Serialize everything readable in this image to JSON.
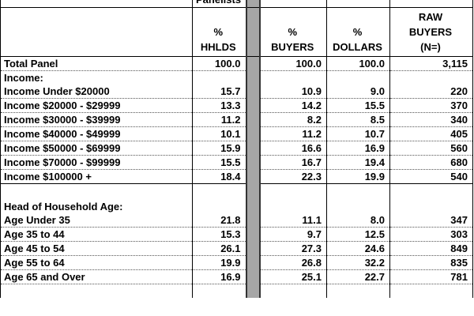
{
  "header": {
    "panelists_label": "Panelists",
    "col_hhlds_pct": "%",
    "col_hhlds": "HHLDS",
    "col_buyers_pct": "%",
    "col_buyers": "BUYERS",
    "col_dollars_pct": "%",
    "col_dollars": "DOLLARS",
    "col_raw_1": "RAW",
    "col_raw_2": "BUYERS",
    "col_raw_3": "(N=)"
  },
  "total": {
    "label": "Total Panel",
    "hhlds": "100.0",
    "buyers": "100.0",
    "dollars": "100.0",
    "raw": "3,115"
  },
  "income": {
    "section_label": "Income:",
    "rows": [
      {
        "label": "Income Under $20000",
        "hhlds": "15.7",
        "buyers": "10.9",
        "dollars": "9.0",
        "raw": "220"
      },
      {
        "label": "Income $20000 - $29999",
        "hhlds": "13.3",
        "buyers": "14.2",
        "dollars": "15.5",
        "raw": "370"
      },
      {
        "label": "Income $30000 - $39999",
        "hhlds": "11.2",
        "buyers": "8.2",
        "dollars": "8.5",
        "raw": "340"
      },
      {
        "label": "Income $40000 - $49999",
        "hhlds": "10.1",
        "buyers": "11.2",
        "dollars": "10.7",
        "raw": "405"
      },
      {
        "label": "Income $50000 - $69999",
        "hhlds": "15.9",
        "buyers": "16.6",
        "dollars": "16.9",
        "raw": "560"
      },
      {
        "label": "Income $70000 - $99999",
        "hhlds": "15.5",
        "buyers": "16.7",
        "dollars": "19.4",
        "raw": "680"
      },
      {
        "label": "Income $100000 +",
        "hhlds": "18.4",
        "buyers": "22.3",
        "dollars": "19.9",
        "raw": "540"
      }
    ]
  },
  "age": {
    "section_label": "Head of Household Age:",
    "rows": [
      {
        "label": "Age Under 35",
        "hhlds": "21.8",
        "buyers": "11.1",
        "dollars": "8.0",
        "raw": "347"
      },
      {
        "label": "Age 35 to 44",
        "hhlds": "15.3",
        "buyers": "9.7",
        "dollars": "12.5",
        "raw": "303"
      },
      {
        "label": "Age 45 to 54",
        "hhlds": "26.1",
        "buyers": "27.3",
        "dollars": "24.6",
        "raw": "849"
      },
      {
        "label": "Age 55 to 64",
        "hhlds": "19.9",
        "buyers": "26.8",
        "dollars": "32.2",
        "raw": "835"
      },
      {
        "label": "Age 65 and Over",
        "hhlds": "16.9",
        "buyers": "25.1",
        "dollars": "22.7",
        "raw": "781"
      }
    ]
  }
}
